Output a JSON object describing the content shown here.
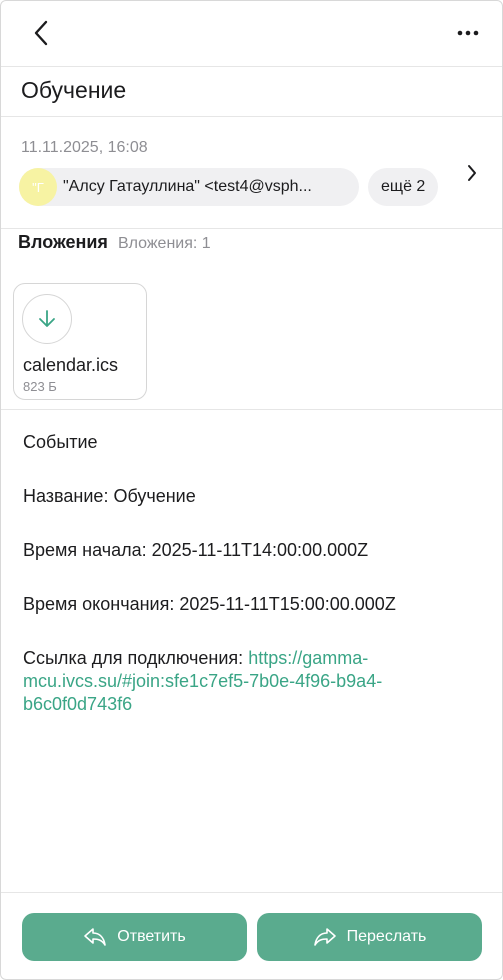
{
  "header": {
    "back_icon": "chevron-left-icon",
    "more_icon": "ellipsis-icon"
  },
  "subject": "Обучение",
  "meta": {
    "date": "11.11.2025, 16:08",
    "avatar_initial": "\"Г",
    "sender": "\"Алсу Гатауллина\" <test4@vsph...",
    "more_recipients": "ещё 2"
  },
  "attachments": {
    "title": "Вложения",
    "count_label": "Вложения: 1",
    "items": [
      {
        "name": "calendar.ics",
        "size": "823 Б"
      }
    ]
  },
  "body": {
    "event": "Событие",
    "name_line": "Название: Обучение",
    "start_line": "Время начала: 2025-11-11T14:00:00.000Z",
    "end_line": "Время окончания: 2025-11-11T15:00:00.000Z",
    "link_label": "Ссылка для подключения:",
    "link_url": "https://gamma-mcu.ivcs.su/#join:sfe1c7ef5-7b0e-4f96-b9a4-b6c0f0d743f6"
  },
  "actions": {
    "reply_label": "Ответить",
    "forward_label": "Переслать"
  },
  "colors": {
    "accent": "#5aab8e",
    "link": "#3aa586",
    "avatar": "#f7f3a3"
  }
}
